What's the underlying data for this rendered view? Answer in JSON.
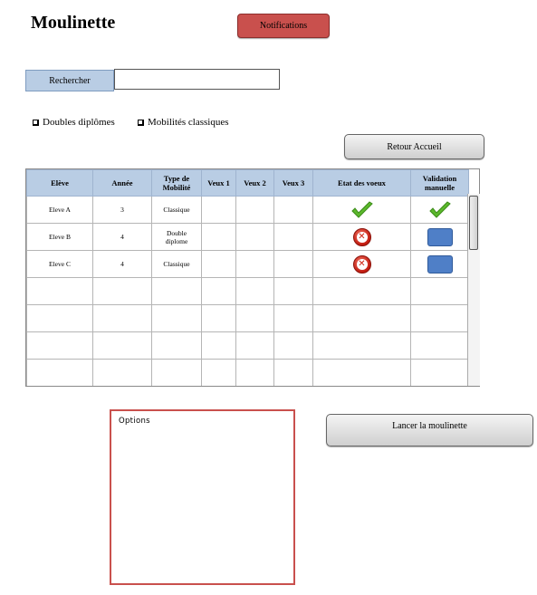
{
  "app": {
    "title": "Moulinette",
    "notifications_label": "Notifications"
  },
  "search": {
    "label": "Rechercher",
    "value": "",
    "placeholder": ""
  },
  "filters": [
    {
      "label": "Doubles diplômes",
      "checked": false
    },
    {
      "label": "Mobilités classiques",
      "checked": false
    }
  ],
  "buttons": {
    "retour": "Retour Accueil",
    "lancer": "Lancer la moulinette"
  },
  "table": {
    "headers": [
      "Elève",
      "Année",
      "Type de Mobilité",
      "Veux 1",
      "Veux 2",
      "Veux 3",
      "Etat des voeux",
      "Validation manuelle"
    ],
    "rows": [
      {
        "eleve": "Eleve A",
        "annee": "3",
        "type": "Classique",
        "v1": "",
        "v2": "",
        "v3": "",
        "etat": "check-icon",
        "validation": "check-icon"
      },
      {
        "eleve": "Eleve B",
        "annee": "4",
        "type": "Double diplome",
        "v1": "",
        "v2": "",
        "v3": "",
        "etat": "error-icon",
        "validation": "blue-button"
      },
      {
        "eleve": "Eleve C",
        "annee": "4",
        "type": "Classique",
        "v1": "",
        "v2": "",
        "v3": "",
        "etat": "error-icon",
        "validation": "blue-button"
      }
    ],
    "empty_rows": 4
  },
  "options": {
    "label": "Options"
  },
  "colors": {
    "accent_red": "#c9504d",
    "header_blue": "#b9cde4",
    "validation_blue": "#4f7fc7",
    "check_green": "#5cb82c",
    "error_red": "#c21c10"
  }
}
